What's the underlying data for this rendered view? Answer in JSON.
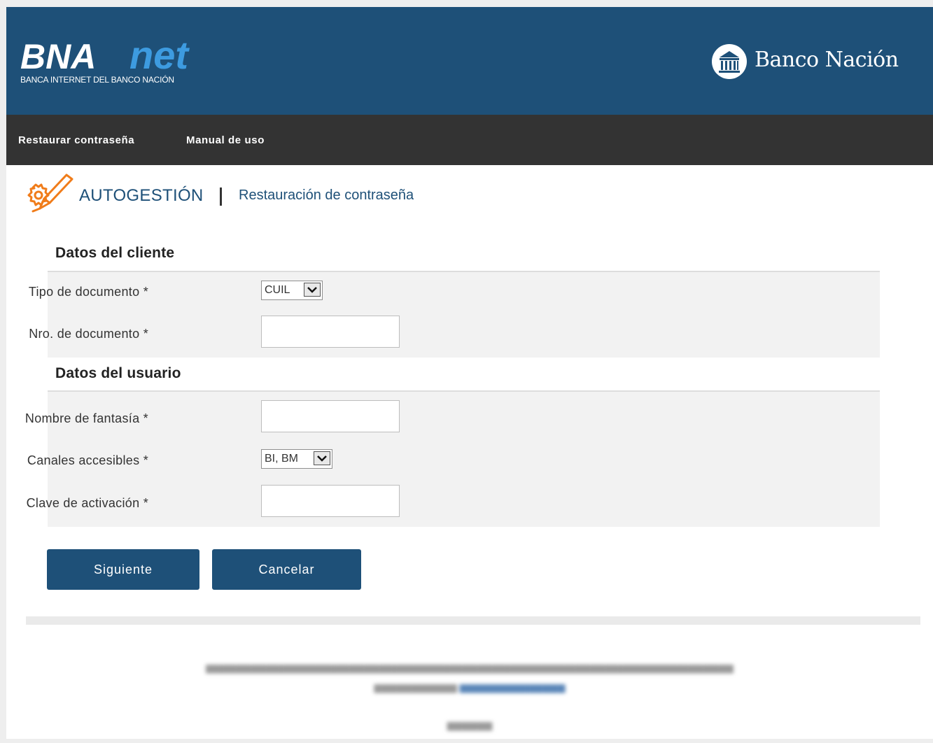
{
  "header": {
    "brand_text": "BNA",
    "brand_text_accent": "net",
    "brand_tagline": "BANCA INTERNET DEL BANCO NACIÓN",
    "bank_name": "Banco Nación",
    "bank_icon": "bank-building-icon"
  },
  "nav": {
    "items": [
      {
        "label": "Restaurar contraseña"
      },
      {
        "label": "Manual de uso"
      }
    ]
  },
  "section": {
    "icon": "gear-pen-icon",
    "title": "AUTOGESTIÓN",
    "subtitle": "Restauración de contraseña"
  },
  "client_group": {
    "heading": "Datos del cliente",
    "doc_type_label": "Tipo de documento *",
    "doc_type_value": "CUIL",
    "doc_number_label": "Nro. de documento *",
    "doc_number_value": ""
  },
  "user_group": {
    "heading": "Datos del usuario",
    "nickname_label": "Nombre de fantasía *",
    "nickname_value": "",
    "channels_label": "Canales accesibles *",
    "channels_value": "BI, BM",
    "activation_label": "Clave de activación *",
    "activation_value": ""
  },
  "actions": {
    "next_label": "Siguiente",
    "cancel_label": "Cancelar"
  },
  "colors": {
    "primary": "#1e5078",
    "nav_bg": "#333333",
    "accent_icon": "#f07c1a",
    "panel_bg": "#f2f2f2"
  }
}
